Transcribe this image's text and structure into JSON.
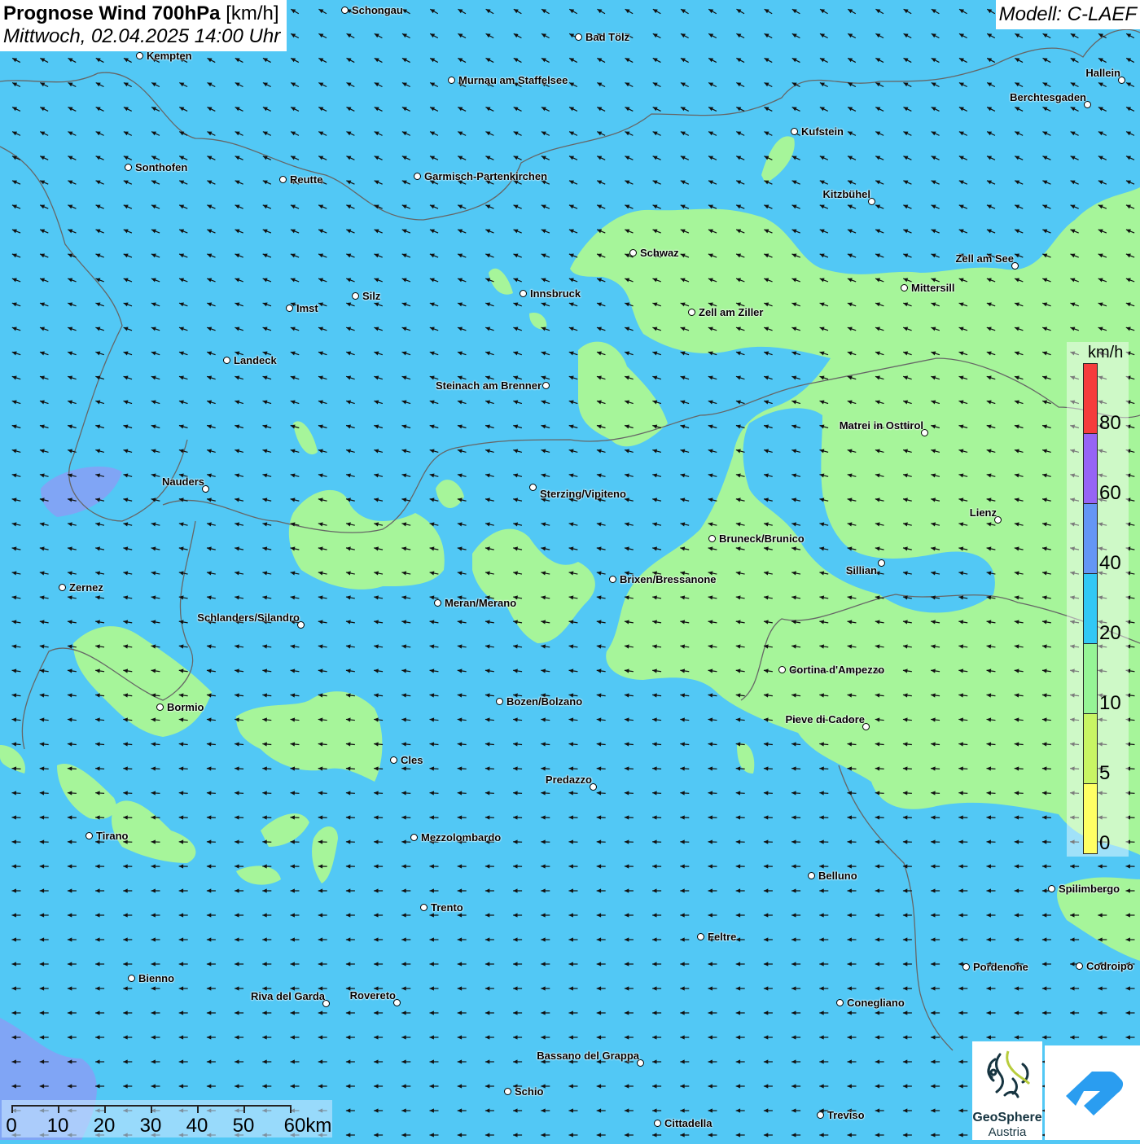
{
  "header": {
    "title_bold": "Prognose Wind 700hPa",
    "title_unit": "[km/h]",
    "datetime": "Mittwoch, 02.04.2025 14:00 Uhr",
    "model": "Modell: C-LAEF"
  },
  "colors": {
    "water_background": "#52c8f5",
    "green_band": "#a6f59a",
    "purple_band": "#8c8cf5"
  },
  "cities": [
    "Schongau",
    "Bad Tölz",
    "Kempten",
    "Murnau am Staffelsee",
    "Hallein",
    "Berchtesgaden",
    "Kufstein",
    "Sonthofen",
    "Reutte",
    "Garmisch-Partenkirchen",
    "Kitzbühel",
    "Schwaz",
    "Zell am See",
    "Mittersill",
    "Innsbruck",
    "Silz",
    "Imst",
    "Zell am Ziller",
    "Landeck",
    "Steinach am Brenner",
    "Matrei in Osttirol",
    "Nauders",
    "Sterzing/Vipiteno",
    "Lienz",
    "Bruneck/Brunico",
    "Sillian",
    "Brixen/Bressanone",
    "Zernez",
    "Meran/Merano",
    "Schlanders/Silandro",
    "Cortina d'Ampezzo",
    "Bozen/Bolzano",
    "Bormio",
    "Pieve di Cadore",
    "Cles",
    "Predazzo",
    "Tirano",
    "Mezzolombardo",
    "Belluno",
    "Spilimbergo",
    "Trento",
    "Feltre",
    "Pordenone",
    "Codroipo",
    "Bienno",
    "Riva del Garda",
    "Rovereto",
    "Conegliano",
    "Bassano del Grappa",
    "Schio",
    "Treviso",
    "Cittadella"
  ],
  "legend": {
    "unit": "km/h",
    "ticks": [
      "80",
      "60",
      "40",
      "20",
      "10",
      "5",
      "0"
    ],
    "colors": [
      "#f53c3c",
      "#9664f5",
      "#6496f5",
      "#32c8f5",
      "#96f596",
      "#c8f564",
      "#ffff64"
    ]
  },
  "scalebar": {
    "labels": [
      "0",
      "10",
      "20",
      "30",
      "40",
      "50",
      "60km"
    ]
  },
  "logos": {
    "geosphere": "GeoSphere",
    "geosphere_sub": "Austria"
  }
}
